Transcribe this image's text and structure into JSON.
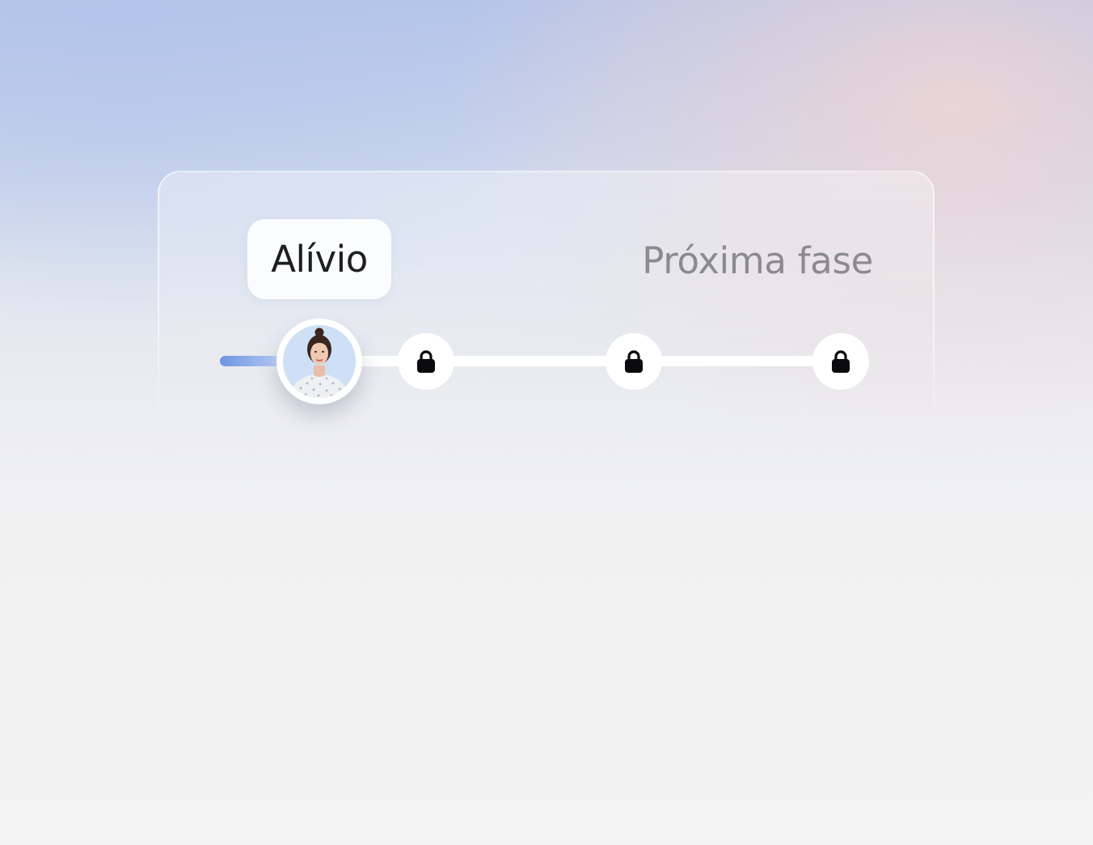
{
  "progress": {
    "current_stage_label": "Alívio",
    "next_stage_label": "Próxima fase",
    "stages": [
      {
        "state": "current",
        "icon": "avatar"
      },
      {
        "state": "locked",
        "icon": "lock-icon"
      },
      {
        "state": "locked",
        "icon": "lock-icon"
      },
      {
        "state": "locked",
        "icon": "lock-icon"
      }
    ]
  },
  "colors": {
    "accent": "#6c95e2",
    "label_text": "#1d1d24",
    "muted_text": "#8a8a90",
    "lock": "#0b0b0d"
  }
}
